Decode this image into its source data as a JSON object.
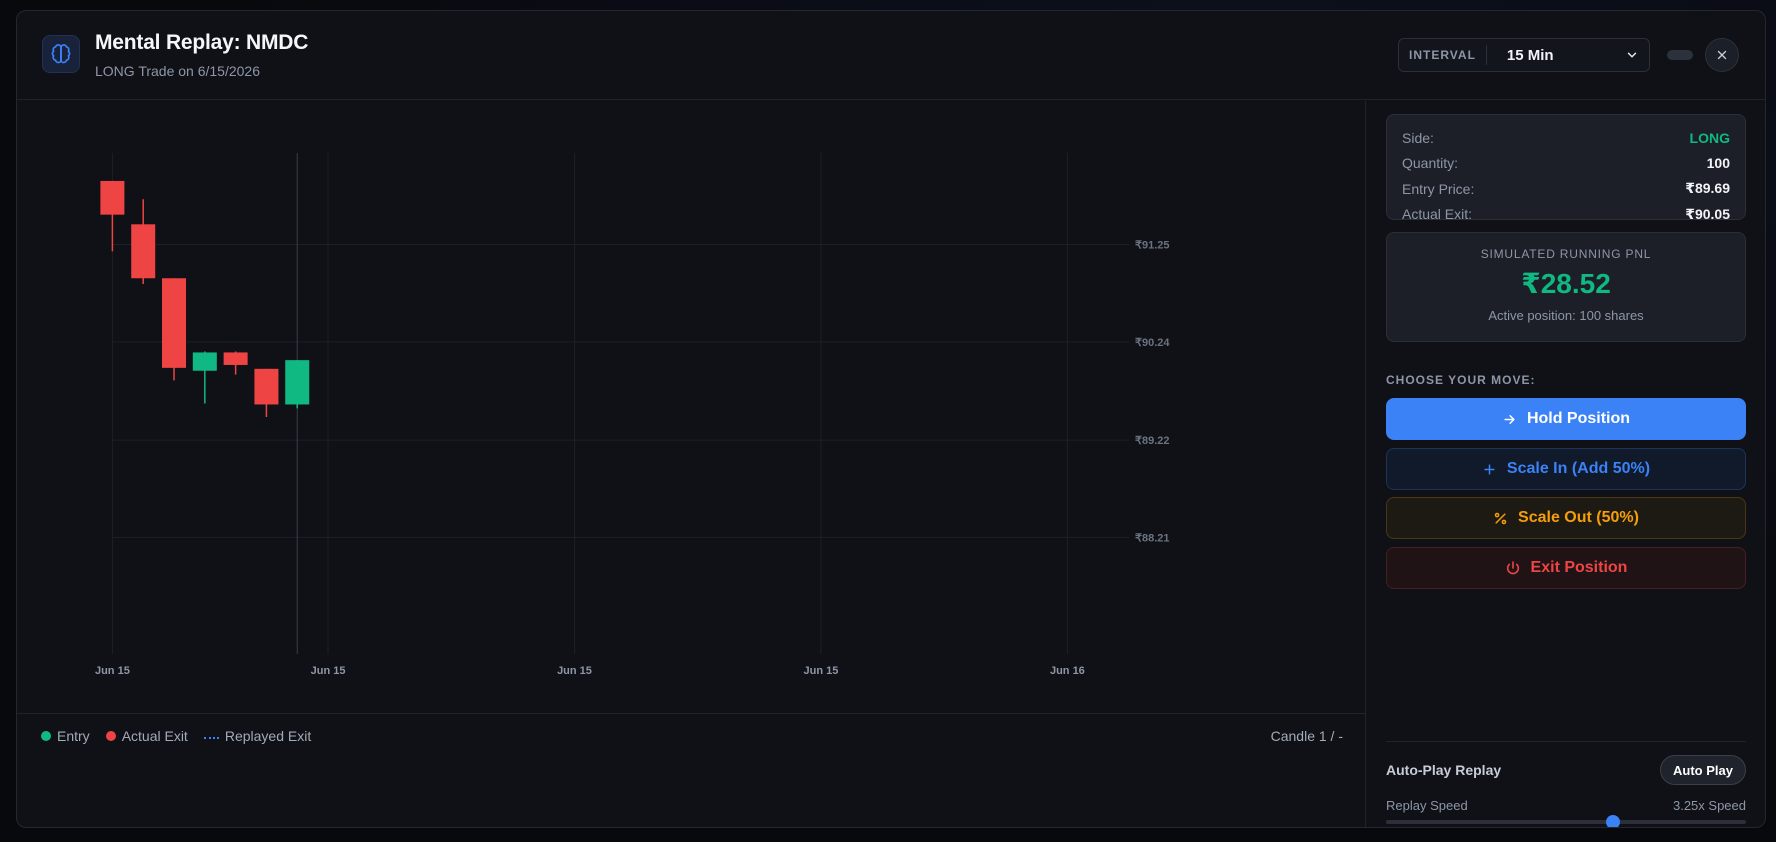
{
  "header": {
    "title": "Mental Replay: NMDC",
    "subtitle": "LONG Trade on 6/15/2026",
    "interval_label": "INTERVAL",
    "interval_value": "15 Min"
  },
  "chart_data": {
    "type": "candlestick",
    "y_ticks": [
      {
        "value": 91.25,
        "label": "₹91.25"
      },
      {
        "value": 90.24,
        "label": "₹90.24"
      },
      {
        "value": 89.22,
        "label": "₹89.22"
      },
      {
        "value": 88.21,
        "label": "₹88.21"
      }
    ],
    "x_ticks": [
      {
        "index": 0,
        "label": "Jun 15"
      },
      {
        "index": 7,
        "label": "Jun 15"
      },
      {
        "index": 15,
        "label": "Jun 15"
      },
      {
        "index": 23,
        "label": "Jun 15"
      },
      {
        "index": 31,
        "label": "Jun 16"
      }
    ],
    "ylim": [
      87.0,
      92.2
    ],
    "xlim": [
      -0.5,
      33.0
    ],
    "candles": [
      {
        "open": 91.91,
        "high": 91.91,
        "low": 91.18,
        "close": 91.56
      },
      {
        "open": 91.46,
        "high": 91.72,
        "low": 90.84,
        "close": 90.9
      },
      {
        "open": 90.9,
        "high": 90.9,
        "low": 89.84,
        "close": 89.97
      },
      {
        "open": 89.94,
        "high": 90.14,
        "low": 89.6,
        "close": 90.13
      },
      {
        "open": 90.13,
        "high": 90.14,
        "low": 89.9,
        "close": 90.0
      },
      {
        "open": 89.96,
        "high": 89.96,
        "low": 89.46,
        "close": 89.59
      },
      {
        "open": 89.59,
        "high": 90.05,
        "low": 89.55,
        "close": 90.05
      }
    ],
    "grid": true,
    "colors": {
      "up": "#10b981",
      "down": "#ef4444"
    }
  },
  "legend": {
    "entry": "Entry",
    "actual_exit": "Actual Exit",
    "replayed_exit": "Replayed Exit",
    "candle_count": "Candle 1 / -",
    "colors": {
      "entry": "#10b981",
      "actual_exit": "#ef4444",
      "replayed_exit": "#3b82f6"
    }
  },
  "trade": {
    "side_label": "Side:",
    "side_value": "LONG",
    "quantity_label": "Quantity:",
    "quantity_value": "100",
    "entry_label": "Entry Price:",
    "entry_value": "₹89.69",
    "exit_label": "Actual Exit:",
    "exit_value": "₹90.05"
  },
  "pnl": {
    "label": "SIMULATED RUNNING PNL",
    "value": "₹28.52",
    "sub": "Active position: 100 shares"
  },
  "moves": {
    "heading": "CHOOSE YOUR MOVE:",
    "hold": "Hold Position",
    "scale_in": "Scale In (Add 50%)",
    "scale_out": "Scale Out (50%)",
    "exit": "Exit Position"
  },
  "autoplay": {
    "title": "Auto-Play Replay",
    "button": "Auto Play",
    "speed_label": "Replay Speed",
    "speed_value": "3.25x Speed",
    "speed_fraction": 0.63
  }
}
